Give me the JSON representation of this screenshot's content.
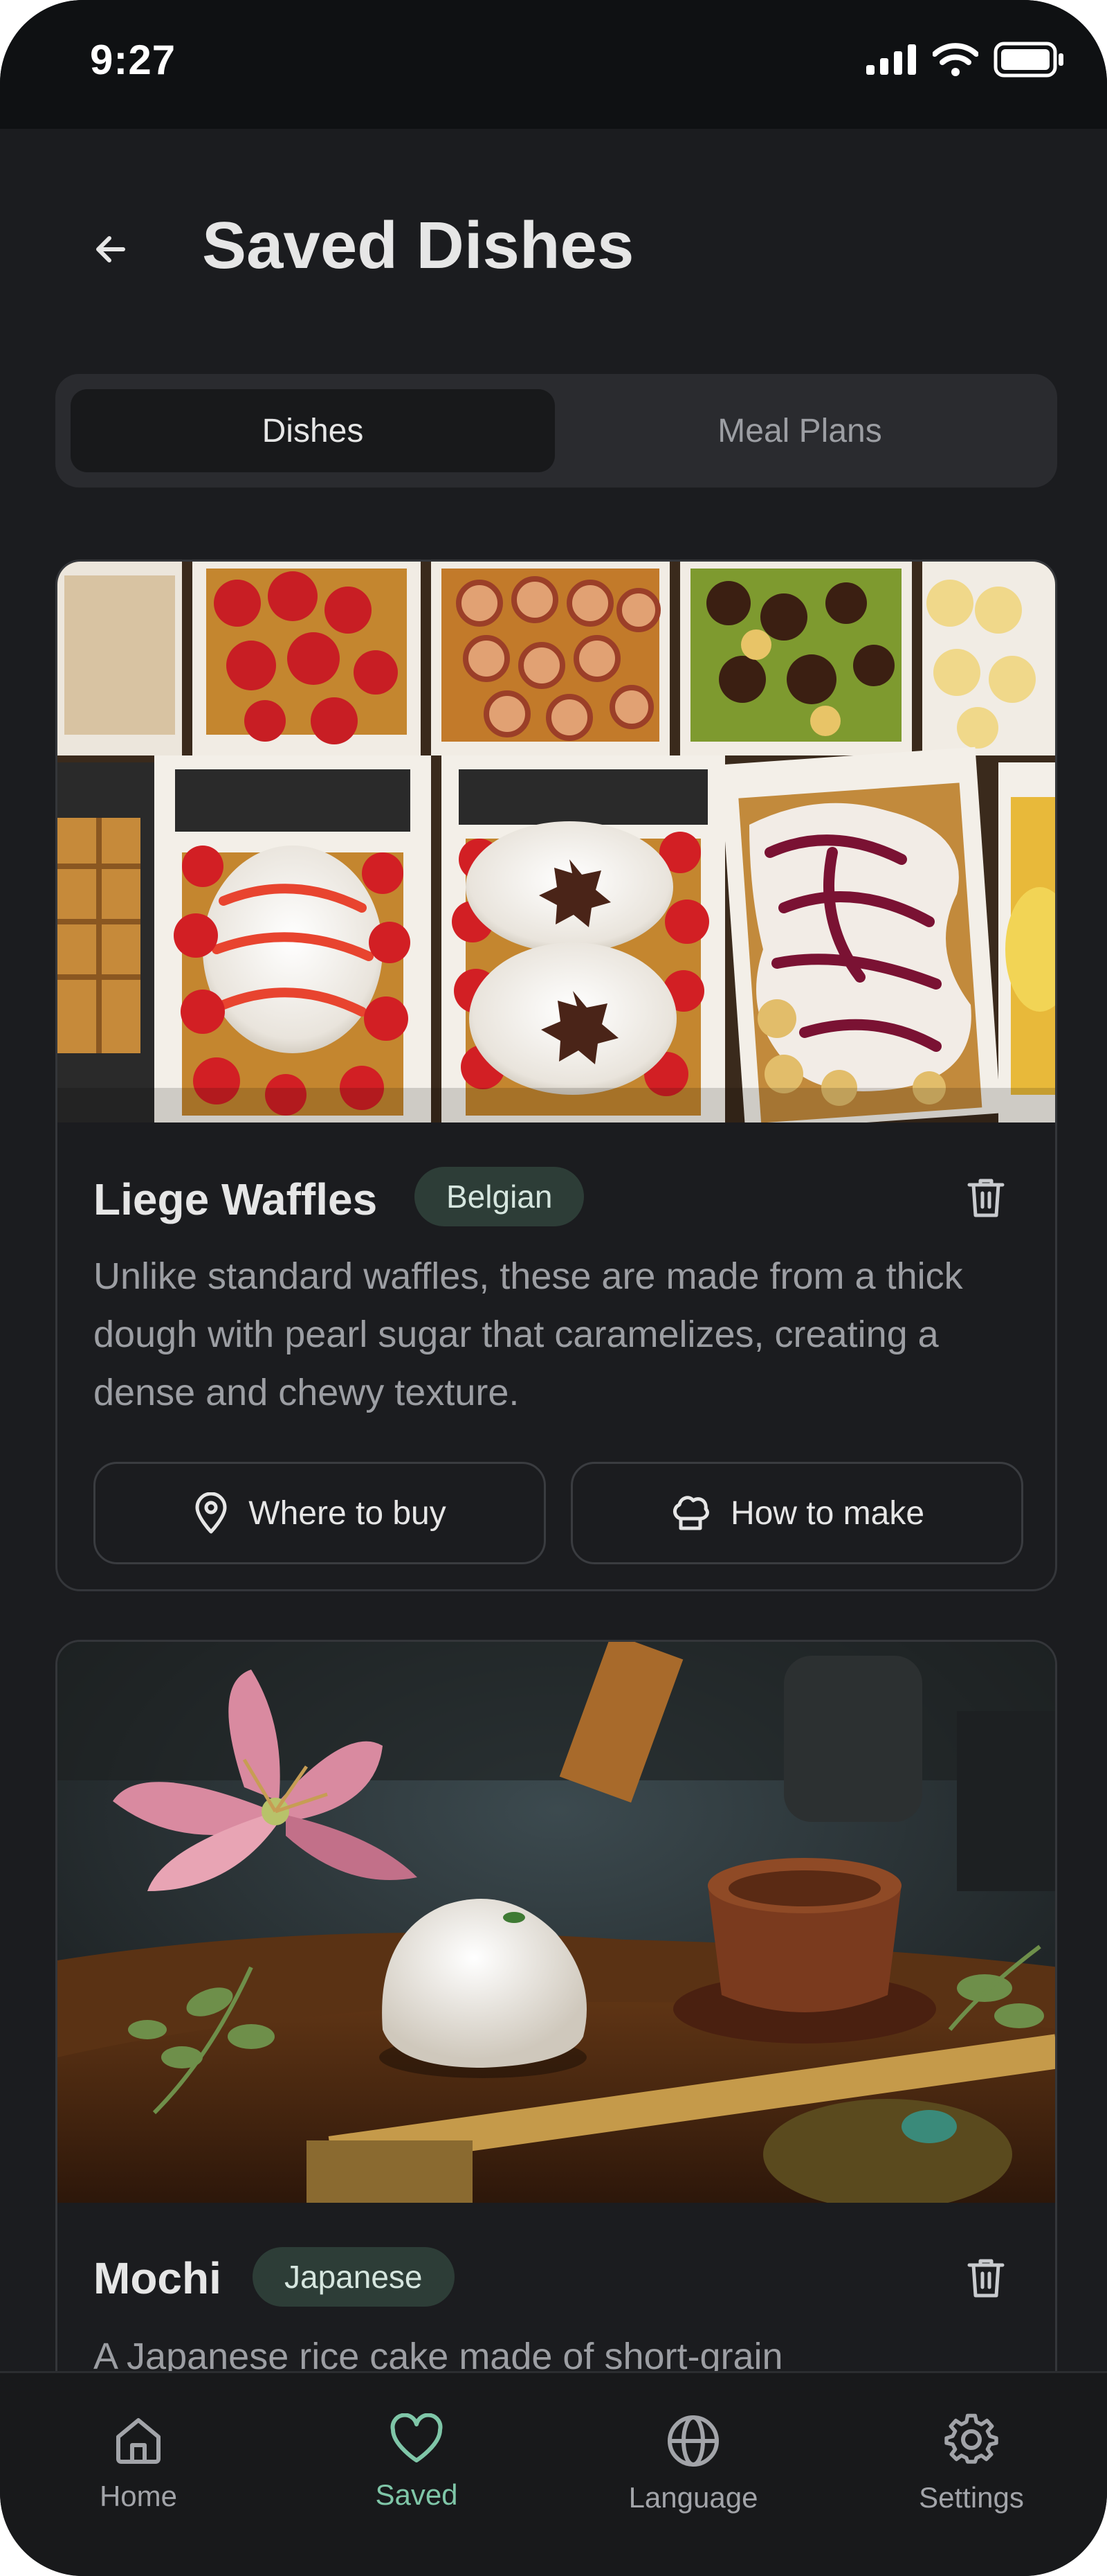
{
  "status": {
    "time": "9:27"
  },
  "header": {
    "title": "Saved Dishes"
  },
  "tabs": [
    {
      "label": "Dishes",
      "active": true
    },
    {
      "label": "Meal Plans",
      "active": false
    }
  ],
  "dishes": [
    {
      "name": "Liege Waffles",
      "tag": "Belgian",
      "description": "Unlike standard waffles, these are made from a thick dough with pearl sugar that caramelizes, creating a dense and chewy texture.",
      "image": "waffles-photo",
      "actions": {
        "where_to_buy": "Where to buy",
        "how_to_make": "How to make"
      }
    },
    {
      "name": "Mochi",
      "tag": "Japanese",
      "description": "A Japanese rice cake made of short-grain",
      "image": "mochi-photo"
    }
  ],
  "nav": [
    {
      "label": "Home",
      "icon": "home-icon",
      "active": false
    },
    {
      "label": "Saved",
      "icon": "heart-icon",
      "active": true
    },
    {
      "label": "Language",
      "icon": "globe-icon",
      "active": false
    },
    {
      "label": "Settings",
      "icon": "gear-icon",
      "active": false
    }
  ],
  "colors": {
    "accent": "#7fc6a8",
    "background": "#1b1c1f",
    "badge": "#2d3d37"
  }
}
